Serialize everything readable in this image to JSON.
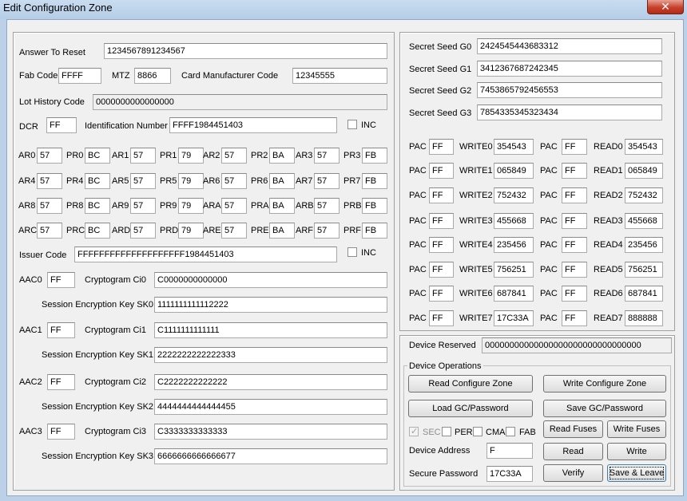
{
  "window": {
    "title": "Edit Configuration Zone",
    "close_glyph": "✕"
  },
  "left": {
    "atr": {
      "label": "Answer To Reset",
      "value": "1234567891234567"
    },
    "fab": {
      "label": "Fab Code",
      "value": "FFFF"
    },
    "mtz": {
      "label": "MTZ",
      "value": "8866"
    },
    "cmc": {
      "label": "Card Manufacturer Code",
      "value": "12345555"
    },
    "lhc": {
      "label": "Lot History Code",
      "value": "0000000000000000"
    },
    "dcr": {
      "label": "DCR",
      "value": "FF"
    },
    "idn": {
      "label": "Identification Number",
      "value": "FFFF1984451403"
    },
    "inc1": {
      "label": "INC"
    },
    "ar_rows": [
      [
        {
          "ar": "AR0",
          "arv": "57",
          "pr": "PR0",
          "prv": "BC"
        },
        {
          "ar": "AR1",
          "arv": "57",
          "pr": "PR1",
          "prv": "79"
        },
        {
          "ar": "AR2",
          "arv": "57",
          "pr": "PR2",
          "prv": "BA"
        },
        {
          "ar": "AR3",
          "arv": "57",
          "pr": "PR3",
          "prv": "FB"
        }
      ],
      [
        {
          "ar": "AR4",
          "arv": "57",
          "pr": "PR4",
          "prv": "BC"
        },
        {
          "ar": "AR5",
          "arv": "57",
          "pr": "PR5",
          "prv": "79"
        },
        {
          "ar": "AR6",
          "arv": "57",
          "pr": "PR6",
          "prv": "BA"
        },
        {
          "ar": "AR7",
          "arv": "57",
          "pr": "PR7",
          "prv": "FB"
        }
      ],
      [
        {
          "ar": "AR8",
          "arv": "57",
          "pr": "PR8",
          "prv": "BC"
        },
        {
          "ar": "AR9",
          "arv": "57",
          "pr": "PR9",
          "prv": "79"
        },
        {
          "ar": "ARA",
          "arv": "57",
          "pr": "PRA",
          "prv": "BA"
        },
        {
          "ar": "ARB",
          "arv": "57",
          "pr": "PRB",
          "prv": "FB"
        }
      ],
      [
        {
          "ar": "ARC",
          "arv": "57",
          "pr": "PRC",
          "prv": "BC"
        },
        {
          "ar": "ARD",
          "arv": "57",
          "pr": "PRD",
          "prv": "79"
        },
        {
          "ar": "ARE",
          "arv": "57",
          "pr": "PRE",
          "prv": "BA"
        },
        {
          "ar": "ARF",
          "arv": "57",
          "pr": "PRF",
          "prv": "FB"
        }
      ]
    ],
    "issuer": {
      "label": "Issuer Code",
      "value": "FFFFFFFFFFFFFFFFFFFF1984451403"
    },
    "inc2": {
      "label": "INC"
    },
    "aac": [
      {
        "label": "AAC0",
        "value": "FF",
        "ci_label": "Cryptogram Ci0",
        "ci": "C0000000000000",
        "sk_label": "Session Encryption Key SK0",
        "sk": "1111111111112222"
      },
      {
        "label": "AAC1",
        "value": "FF",
        "ci_label": "Cryptogram Ci1",
        "ci": "C1111111111111",
        "sk_label": "Session Encryption Key SK1",
        "sk": "2222222222222333"
      },
      {
        "label": "AAC2",
        "value": "FF",
        "ci_label": "Cryptogram Ci2",
        "ci": "C2222222222222",
        "sk_label": "Session Encryption Key SK2",
        "sk": "4444444444444455"
      },
      {
        "label": "AAC3",
        "value": "FF",
        "ci_label": "Cryptogram Ci3",
        "ci": "C3333333333333",
        "sk_label": "Session Encryption Key SK3",
        "sk": "6666666666666677"
      }
    ]
  },
  "right": {
    "seeds": [
      {
        "label": "Secret Seed G0",
        "value": "2424545443683312"
      },
      {
        "label": "Secret Seed G1",
        "value": "3412367687242345"
      },
      {
        "label": "Secret Seed G2",
        "value": "7453865792456553"
      },
      {
        "label": "Secret Seed G3",
        "value": "7854335345323434"
      }
    ],
    "pac_rows": [
      {
        "pac1": "PAC",
        "pac1v": "FF",
        "w": "WRITE0",
        "wv": "354543",
        "pac2": "PAC",
        "pac2v": "FF",
        "r": "READ0",
        "rv": "354543"
      },
      {
        "pac1": "PAC",
        "pac1v": "FF",
        "w": "WRITE1",
        "wv": "065849",
        "pac2": "PAC",
        "pac2v": "FF",
        "r": "READ1",
        "rv": "065849"
      },
      {
        "pac1": "PAC",
        "pac1v": "FF",
        "w": "WRITE2",
        "wv": "752432",
        "pac2": "PAC",
        "pac2v": "FF",
        "r": "READ2",
        "rv": "752432"
      },
      {
        "pac1": "PAC",
        "pac1v": "FF",
        "w": "WRITE3",
        "wv": "455668",
        "pac2": "PAC",
        "pac2v": "FF",
        "r": "READ3",
        "rv": "455668"
      },
      {
        "pac1": "PAC",
        "pac1v": "FF",
        "w": "WRITE4",
        "wv": "235456",
        "pac2": "PAC",
        "pac2v": "FF",
        "r": "READ4",
        "rv": "235456"
      },
      {
        "pac1": "PAC",
        "pac1v": "FF",
        "w": "WRITE5",
        "wv": "756251",
        "pac2": "PAC",
        "pac2v": "FF",
        "r": "READ5",
        "rv": "756251"
      },
      {
        "pac1": "PAC",
        "pac1v": "FF",
        "w": "WRITE6",
        "wv": "687841",
        "pac2": "PAC",
        "pac2v": "FF",
        "r": "READ6",
        "rv": "687841"
      },
      {
        "pac1": "PAC",
        "pac1v": "FF",
        "w": "WRITE7",
        "wv": "17C33A",
        "pac2": "PAC",
        "pac2v": "FF",
        "r": "READ7",
        "rv": "888888"
      }
    ],
    "device_reserved": {
      "label": "Device Reserved",
      "value": "00000000000000000000000000000000"
    },
    "ops": {
      "title": "Device Operations",
      "read_cfg": "Read Configure Zone",
      "write_cfg": "Write Configure Zone",
      "load_gc": "Load GC/Password",
      "save_gc": "Save GC/Password",
      "sec": "SEC",
      "per": "PER",
      "cma": "CMA",
      "fab": "FAB",
      "read_fuses": "Read Fuses",
      "write_fuses": "Write Fuses",
      "dev_addr_label": "Device Address",
      "dev_addr": "F",
      "read": "Read",
      "write": "Write",
      "pwd_label": "Secure Password",
      "pwd": "17C33A",
      "verify": "Verify",
      "save_leave": "Save & Leave"
    }
  }
}
